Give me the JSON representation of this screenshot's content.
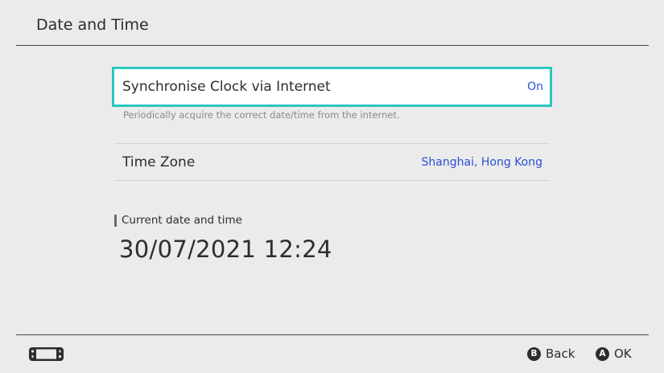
{
  "header": {
    "title": "Date and Time"
  },
  "settings": {
    "sync_clock": {
      "label": "Synchronise Clock via Internet",
      "value": "On",
      "description": "Periodically acquire the correct date/time from the internet."
    },
    "time_zone": {
      "label": "Time Zone",
      "value": "Shanghai, Hong Kong"
    }
  },
  "current": {
    "section_label": "Current date and time",
    "datetime": "30/07/2021 12:24"
  },
  "footer": {
    "console_icon": "console-handheld-icon",
    "back": {
      "glyph": "B",
      "label": "Back"
    },
    "ok": {
      "glyph": "A",
      "label": "OK"
    }
  },
  "colors": {
    "background": "#ebebeb",
    "focus_border": "#29c7c0",
    "value_text": "#2b4fd6",
    "text": "#2d2d2d"
  }
}
